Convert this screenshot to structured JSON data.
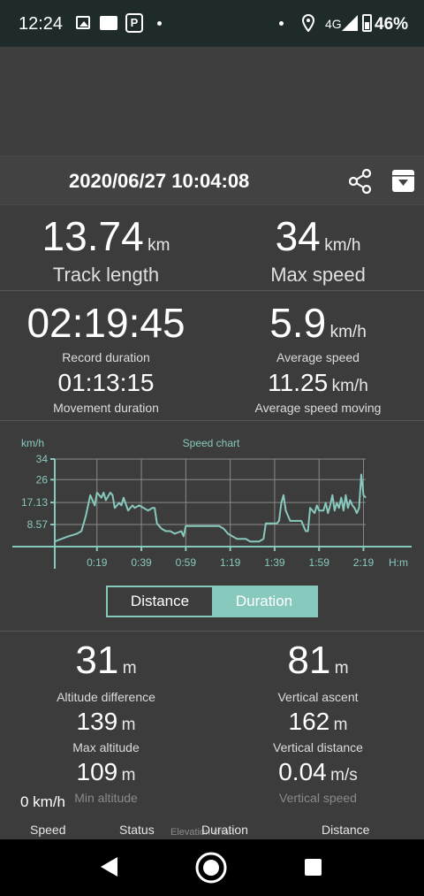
{
  "status_bar": {
    "time": "12:24",
    "network": "4G",
    "battery": "46%"
  },
  "header": {
    "datetime": "2020/06/27 10:04:08"
  },
  "stats": {
    "track_length_value": "13.74",
    "track_length_unit": "km",
    "track_length_label": "Track length",
    "max_speed_value": "34",
    "max_speed_unit": "km/h",
    "max_speed_label": "Max speed",
    "record_duration_value": "02:19:45",
    "record_duration_label": "Record duration",
    "avg_speed_value": "5.9",
    "avg_speed_unit": "km/h",
    "avg_speed_label": "Average speed",
    "movement_duration_value": "01:13:15",
    "movement_duration_label": "Movement duration",
    "avg_speed_moving_value": "11.25",
    "avg_speed_moving_unit": "km/h",
    "avg_speed_moving_label": "Average speed moving"
  },
  "chart_data": {
    "type": "line",
    "title": "Speed chart",
    "ylabel": "km/h",
    "xlabel": "H:m",
    "y_ticks": [
      "34",
      "26",
      "17.13",
      "8.57"
    ],
    "y_tick_values": [
      34,
      26,
      17.13,
      8.57
    ],
    "x_ticks": [
      "0:19",
      "0:39",
      "0:59",
      "1:19",
      "1:39",
      "1:59",
      "2:19"
    ],
    "x_tick_values": [
      19,
      39,
      59,
      79,
      99,
      119,
      139
    ],
    "xlim": [
      0,
      140
    ],
    "ylim": [
      0,
      34
    ],
    "grid": true,
    "color": "#88c9be",
    "series": [
      {
        "x": [
          0,
          3,
          6,
          10,
          12,
          14,
          16,
          18,
          19,
          21,
          22,
          23,
          25,
          26,
          27,
          29,
          30,
          31,
          33,
          35,
          36,
          38,
          40,
          42,
          44,
          45,
          46,
          48,
          50,
          52,
          54,
          57,
          58,
          59,
          62,
          66,
          70,
          74,
          76,
          78,
          82,
          86,
          88,
          92,
          94,
          95,
          97,
          100,
          101,
          102,
          103,
          104,
          106,
          108,
          110,
          111,
          112,
          113,
          114,
          115,
          117,
          118,
          119,
          121,
          122,
          123,
          124,
          125,
          126,
          127,
          128,
          129,
          130,
          131,
          132,
          133,
          134,
          135,
          136,
          137,
          138,
          139,
          140
        ],
        "y": [
          2,
          3,
          4,
          5,
          6,
          12,
          20,
          16,
          21,
          19,
          21,
          18,
          21,
          20,
          15,
          17,
          16,
          19,
          14,
          16,
          15,
          16,
          15,
          14,
          15,
          15,
          9,
          7,
          6,
          6,
          5,
          6,
          4,
          8,
          8,
          8,
          8,
          8,
          7,
          5,
          3,
          3,
          2,
          2,
          3,
          9,
          9,
          9,
          10,
          17,
          20,
          14,
          10,
          10,
          10,
          10,
          8,
          6,
          6,
          15,
          13,
          16,
          14,
          14,
          17,
          13,
          16,
          20,
          14,
          17,
          15,
          19,
          14,
          20,
          15,
          18,
          16,
          15,
          13,
          15,
          28,
          20,
          19
        ]
      }
    ]
  },
  "mode_toggle": {
    "distance_label": "Distance",
    "duration_label": "Duration",
    "selected": "Duration"
  },
  "altitude": {
    "alt_diff_value": "31",
    "alt_diff_unit": "m",
    "alt_diff_label": "Altitude difference",
    "vert_ascent_value": "81",
    "vert_ascent_unit": "m",
    "vert_ascent_label": "Vertical ascent",
    "max_alt_value": "139",
    "max_alt_unit": "m",
    "max_alt_label": "Max altitude",
    "vert_distance_value": "162",
    "vert_distance_unit": "m",
    "vert_distance_label": "Vertical distance",
    "min_alt_value": "109",
    "min_alt_unit": "m",
    "min_alt_label": "Min altitude",
    "vert_speed_value": "0.04",
    "vert_speed_unit": "m/s",
    "vert_speed_label": "Vertical speed",
    "current_speed": "0 km/h",
    "elevation_chart_label": "Elevation chart"
  },
  "tabs": {
    "speed": "Speed",
    "status": "Status",
    "duration": "Duration",
    "distance": "Distance"
  },
  "icons": {
    "share": "share-icon",
    "archive": "archive-icon"
  }
}
